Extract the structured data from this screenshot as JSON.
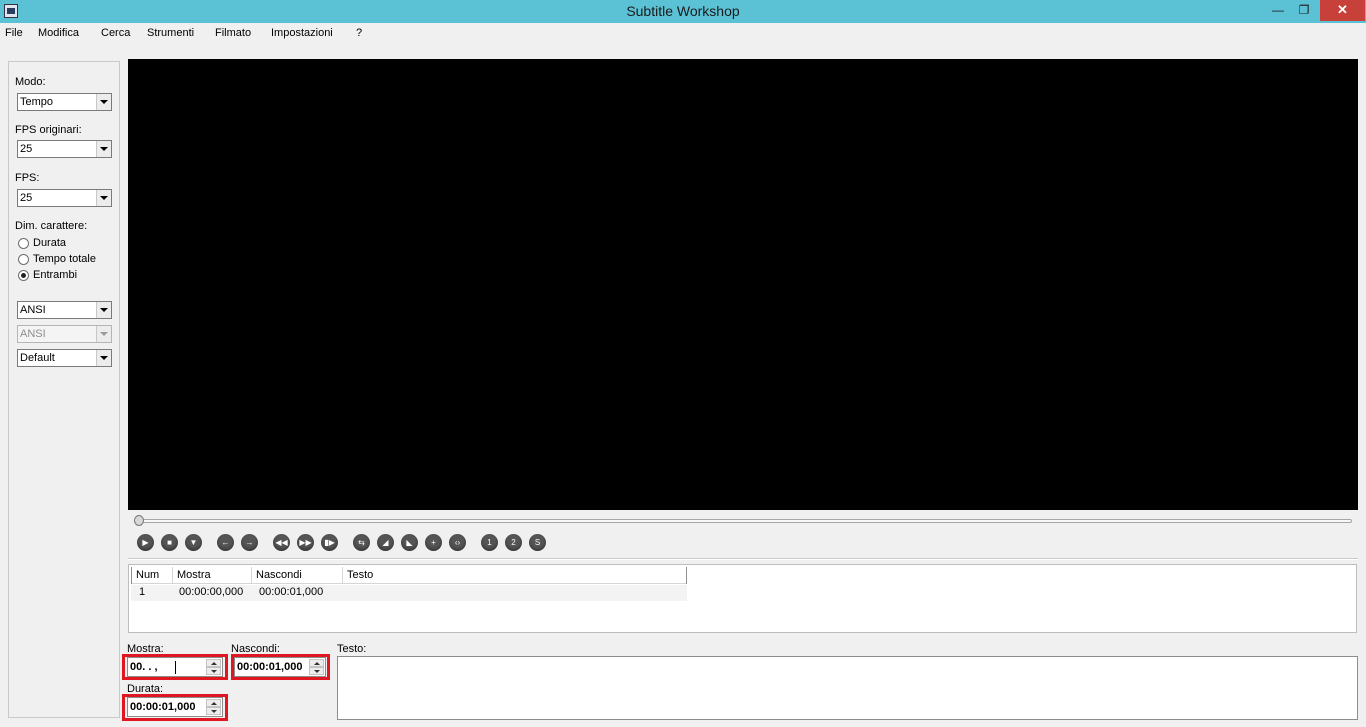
{
  "window": {
    "title": "Subtitle Workshop",
    "minimize_glyph": "—",
    "restore_glyph": "❐",
    "close_glyph": "✕"
  },
  "menu": [
    {
      "label": "File"
    },
    {
      "label": "Modifica"
    },
    {
      "label": "Cerca"
    },
    {
      "label": "Strumenti"
    },
    {
      "label": "Filmato"
    },
    {
      "label": "Impostazioni"
    },
    {
      "label": "?"
    }
  ],
  "left_panel": {
    "mode_label": "Modo:",
    "mode_value": "Tempo",
    "orig_fps_label": "FPS originari:",
    "orig_fps_value": "25",
    "fps_label": "FPS:",
    "fps_value": "25",
    "char_dim_label": "Dim. carattere:",
    "radios": [
      {
        "label": "Durata",
        "checked": false
      },
      {
        "label": "Tempo totale",
        "checked": false
      },
      {
        "label": "Entrambi",
        "checked": true
      }
    ],
    "charset_1": "ANSI",
    "charset_2": "ANSI",
    "style": "Default"
  },
  "player": {
    "position_fraction": 0,
    "buttons": [
      {
        "icon": "play-icon",
        "glyph": "▶"
      },
      {
        "icon": "stop-icon",
        "glyph": "■"
      },
      {
        "icon": "down-arrow-icon",
        "glyph": "▼"
      },
      {
        "icon": "back-arrow-icon",
        "glyph": "←"
      },
      {
        "icon": "forward-arrow-icon",
        "glyph": "→"
      },
      {
        "icon": "rewind-icon",
        "glyph": "◀◀"
      },
      {
        "icon": "fast-forward-icon",
        "glyph": "▶▶"
      },
      {
        "icon": "next-frame-icon",
        "glyph": "▮▶"
      },
      {
        "icon": "sync-icon",
        "glyph": "⇆"
      },
      {
        "icon": "set-start-icon",
        "glyph": "◢"
      },
      {
        "icon": "set-end-icon",
        "glyph": "◣"
      },
      {
        "icon": "add-subtitle-icon",
        "glyph": "+"
      },
      {
        "icon": "code-icon",
        "glyph": "‹›"
      },
      {
        "icon": "mark-1-icon",
        "glyph": "1"
      },
      {
        "icon": "mark-2-icon",
        "glyph": "2"
      },
      {
        "icon": "mark-s-icon",
        "glyph": "S"
      }
    ]
  },
  "subtitle_table": {
    "columns": [
      "Num",
      "Mostra",
      "Nascondi",
      "Testo"
    ],
    "rows": [
      {
        "num": "1",
        "show": "00:00:00,000",
        "hide": "00:00:01,000",
        "text": ""
      }
    ]
  },
  "editor": {
    "show_label": "Mostra:",
    "show_value": "00.  .  ,",
    "hide_label": "Nascondi:",
    "hide_value": "00:00:01,000",
    "duration_label": "Durata:",
    "duration_value": "00:00:01,000",
    "text_label": "Testo:",
    "highlight_color": "#e01620"
  }
}
